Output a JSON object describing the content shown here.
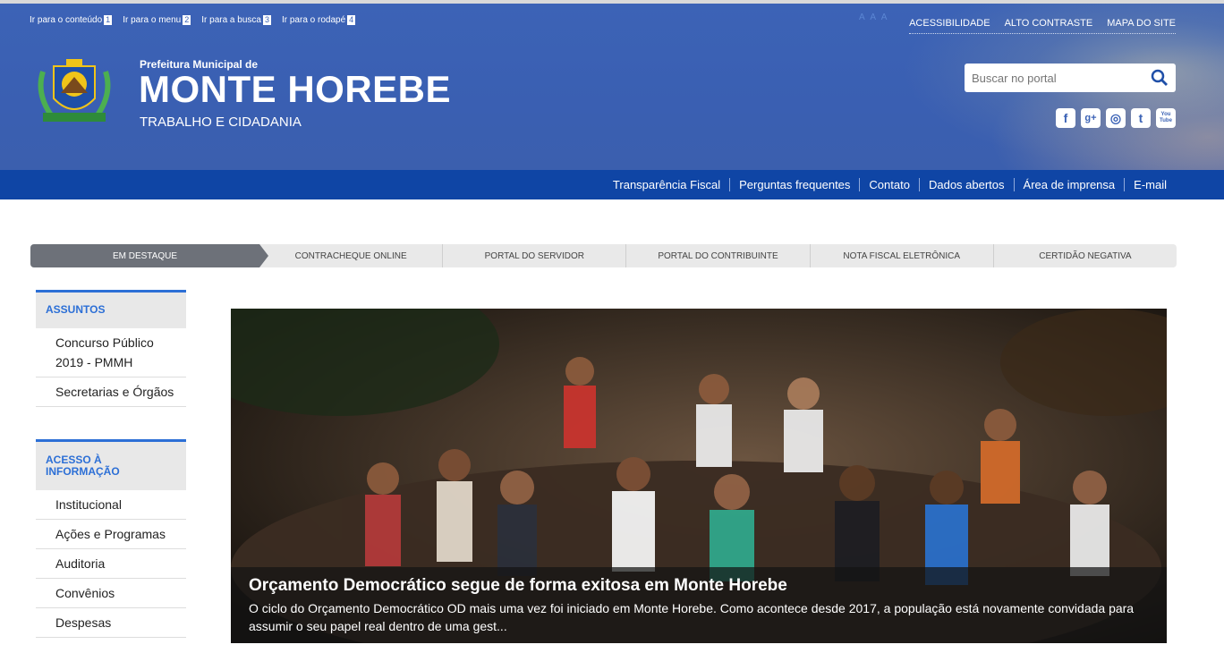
{
  "skip_links": [
    {
      "label": "Ir para o conteúdo",
      "num": "1"
    },
    {
      "label": "Ir para o menu",
      "num": "2"
    },
    {
      "label": "Ir para a busca",
      "num": "3"
    },
    {
      "label": "Ir para o rodapé",
      "num": "4"
    }
  ],
  "font_controls": "A A A",
  "accessibility_links": [
    "ACESSIBILIDADE",
    "ALTO CONTRASTE",
    "MAPA DO SITE"
  ],
  "header": {
    "pre_title": "Prefeitura Municipal de",
    "title": "MONTE HOREBE",
    "subtitle": "TRABALHO E CIDADANIA"
  },
  "search": {
    "placeholder": "Buscar no portal"
  },
  "social": [
    "f",
    "g+",
    "◎",
    "t",
    "You Tube"
  ],
  "navbar": [
    "Transparência Fiscal",
    "Perguntas frequentes",
    "Contato",
    "Dados abertos",
    "Área de imprensa",
    "E-mail"
  ],
  "tabs": [
    "EM DESTAQUE",
    "CONTRACHEQUE ONLINE",
    "PORTAL DO SERVIDOR",
    "PORTAL DO CONTRIBUINTE",
    "NOTA FISCAL ELETRÔNICA",
    "CERTIDÃO NEGATIVA"
  ],
  "sidebar": {
    "sections": [
      {
        "title": "ASSUNTOS",
        "items": [
          "Concurso Público 2019 - PMMH",
          "Secretarias e Órgãos"
        ]
      },
      {
        "title": "ACESSO À INFORMAÇÃO",
        "items": [
          "Institucional",
          "Ações e Programas",
          "Auditoria",
          "Convênios",
          "Despesas"
        ]
      }
    ]
  },
  "feature": {
    "title": "Orçamento Democrático segue de forma exitosa em Monte Horebe",
    "summary": "O ciclo do Orçamento Democrático OD mais uma vez foi iniciado em Monte Horebe. Como acontece desde 2017, a população está novamente convidada para assumir o seu papel real dentro de uma gest..."
  },
  "colors": {
    "header_blue": "#3c63b6",
    "navbar_blue": "#0f45a5",
    "accent": "#2c6fd6"
  }
}
